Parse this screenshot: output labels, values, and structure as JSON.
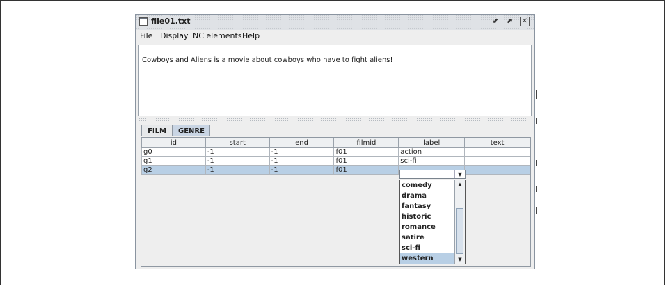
{
  "window": {
    "title": "file01.txt",
    "buttons": {
      "minimize": "⬋",
      "maximize": "⬈",
      "close": "✕"
    }
  },
  "menu": [
    "File",
    "Display",
    "NC elements",
    "Help"
  ],
  "document": {
    "text": "Cowboys and Aliens is a movie about cowboys who have to fight aliens!"
  },
  "tabs": [
    {
      "label": "FILM",
      "active": false
    },
    {
      "label": "GENRE",
      "active": true
    }
  ],
  "table": {
    "columns": [
      "id",
      "start",
      "end",
      "filmid",
      "label",
      "text"
    ],
    "rows": [
      {
        "id": "g0",
        "start": "-1",
        "end": "-1",
        "filmid": "f01",
        "label": "action",
        "text": ""
      },
      {
        "id": "g1",
        "start": "-1",
        "end": "-1",
        "filmid": "f01",
        "label": "sci-fi",
        "text": ""
      },
      {
        "id": "g2",
        "start": "-1",
        "end": "-1",
        "filmid": "f01",
        "label": "",
        "text": ""
      }
    ],
    "selected_row": 2
  },
  "dropdown": {
    "options": [
      "comedy",
      "drama",
      "fantasy",
      "historic",
      "romance",
      "satire",
      "sci-fi",
      "western"
    ],
    "highlighted": "western"
  },
  "colors": {
    "selection": "#b8cfe5",
    "active_tab": "#c9d5e4"
  }
}
